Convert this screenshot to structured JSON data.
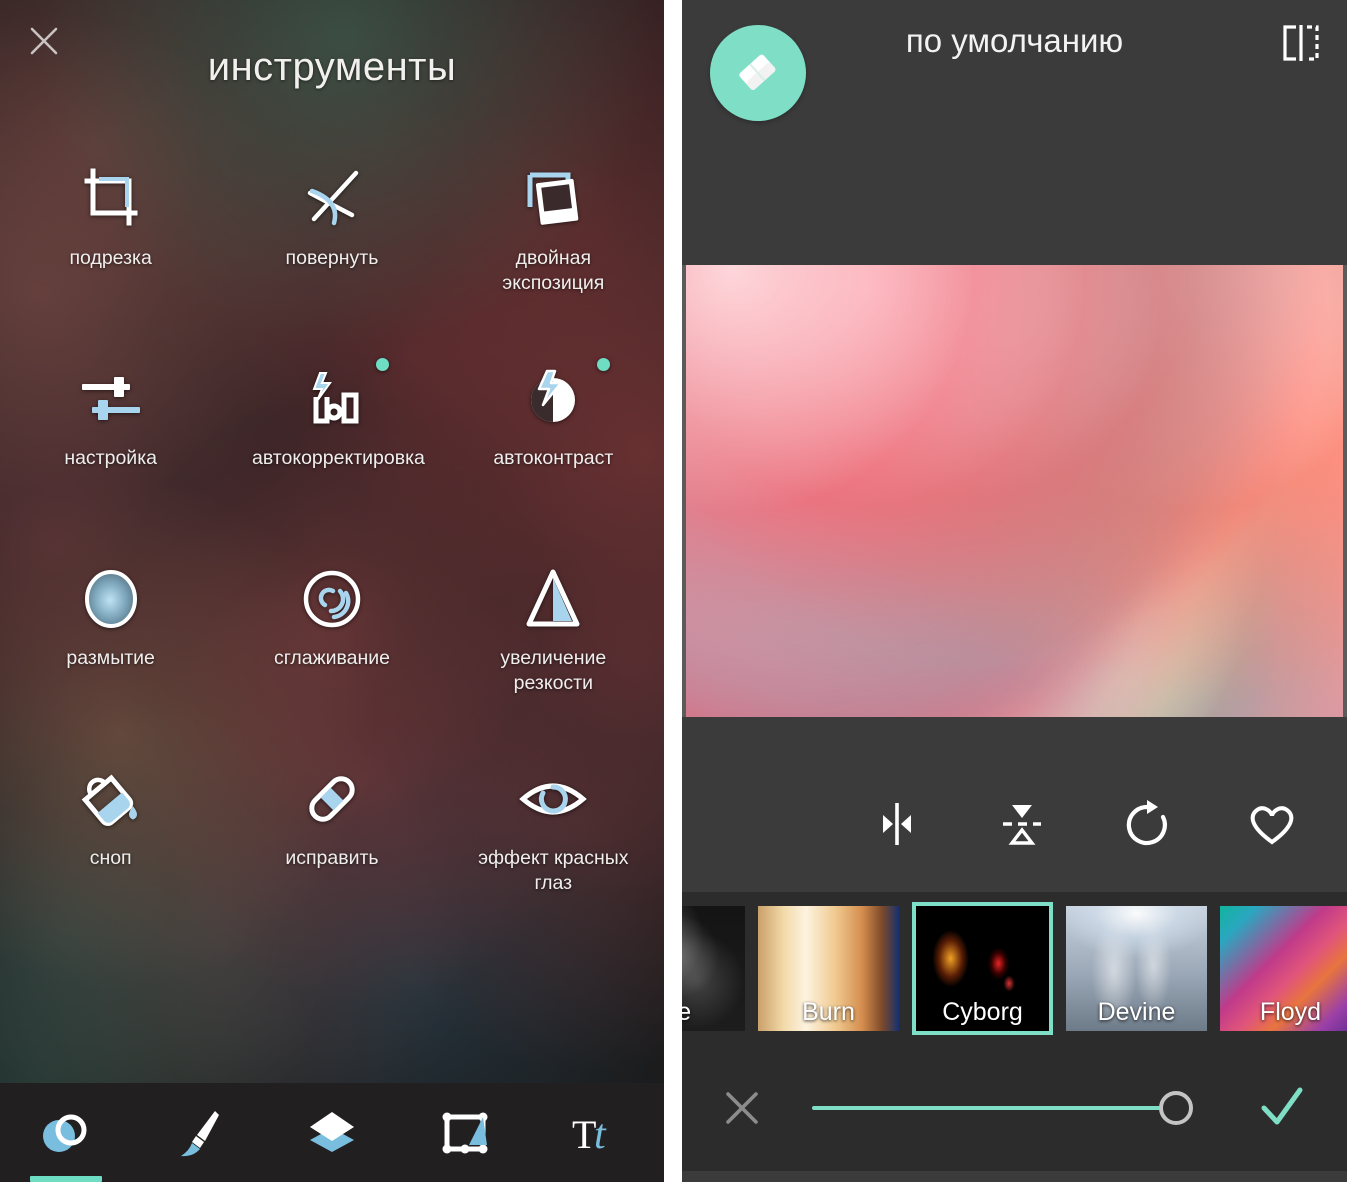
{
  "left_panel": {
    "close_icon": "close-icon",
    "title": "инструменты",
    "tools": [
      {
        "label": "подрезка",
        "icon": "crop-icon",
        "badge": false
      },
      {
        "label": "повернуть",
        "icon": "rotate-icon",
        "badge": false
      },
      {
        "label": "двойная экспозиция",
        "icon": "double-exposure-icon",
        "badge": false
      },
      {
        "label": "настройка",
        "icon": "adjust-sliders-icon",
        "badge": false
      },
      {
        "label": "автокорректировка",
        "icon": "auto-correct-icon",
        "badge": true
      },
      {
        "label": "автоконтраст",
        "icon": "auto-contrast-icon",
        "badge": true
      },
      {
        "label": "размытие",
        "icon": "blur-icon",
        "badge": false
      },
      {
        "label": "сглаживание",
        "icon": "smooth-icon",
        "badge": false
      },
      {
        "label": "увеличение резкости",
        "icon": "sharpen-icon",
        "badge": false
      },
      {
        "label": "сноп",
        "icon": "paint-bucket-icon",
        "badge": false
      },
      {
        "label": "исправить",
        "icon": "bandage-fix-icon",
        "badge": false
      },
      {
        "label": "эффект красных глаз",
        "icon": "red-eye-icon",
        "badge": false
      }
    ],
    "tabbar": [
      {
        "name": "tab-effects",
        "icon": "overlapping-circles-icon",
        "active": true
      },
      {
        "name": "tab-brush",
        "icon": "paintbrush-icon",
        "active": false
      },
      {
        "name": "tab-layers",
        "icon": "layers-diamond-icon",
        "active": false
      },
      {
        "name": "tab-frames",
        "icon": "frame-icon",
        "active": false
      },
      {
        "name": "tab-text",
        "icon": "text-tt-icon",
        "active": false
      }
    ]
  },
  "right_panel": {
    "header": {
      "fab_icon": "eraser-icon",
      "title": "по умолчанию",
      "compare_icon": "before-after-compare-icon"
    },
    "photo": {
      "name": "bokeh-christmas-lights-photo"
    },
    "toolrow": [
      {
        "name": "flip-horizontal-button",
        "icon": "flip-horizontal-icon"
      },
      {
        "name": "flip-vertical-button",
        "icon": "flip-vertical-icon"
      },
      {
        "name": "rotate-button",
        "icon": "rotate-cw-icon"
      },
      {
        "name": "favorite-button",
        "icon": "heart-icon"
      }
    ],
    "filters": [
      {
        "label": "ble",
        "swatch": "t-noble",
        "selected": false,
        "clipped": true
      },
      {
        "label": "Burn",
        "swatch": "t-burn",
        "selected": false,
        "clipped": false
      },
      {
        "label": "Cyborg",
        "swatch": "t-cyborg",
        "selected": true,
        "clipped": false
      },
      {
        "label": "Devine",
        "swatch": "t-devine",
        "selected": false,
        "clipped": false
      },
      {
        "label": "Floyd",
        "swatch": "t-floyd",
        "selected": false,
        "clipped": false
      },
      {
        "label": "",
        "swatch": "t-dark",
        "selected": false,
        "clipped": false
      }
    ],
    "slider": {
      "cancel_icon": "close-icon",
      "confirm_icon": "check-icon",
      "value_percent": 100
    }
  },
  "colors": {
    "accent_teal": "#7fdfc6",
    "icon_blue": "#a9d4ee",
    "panel_bg": "#3b3b3b",
    "strip_bg": "#2c2c2c",
    "tabbar_bg": "#221f20"
  }
}
